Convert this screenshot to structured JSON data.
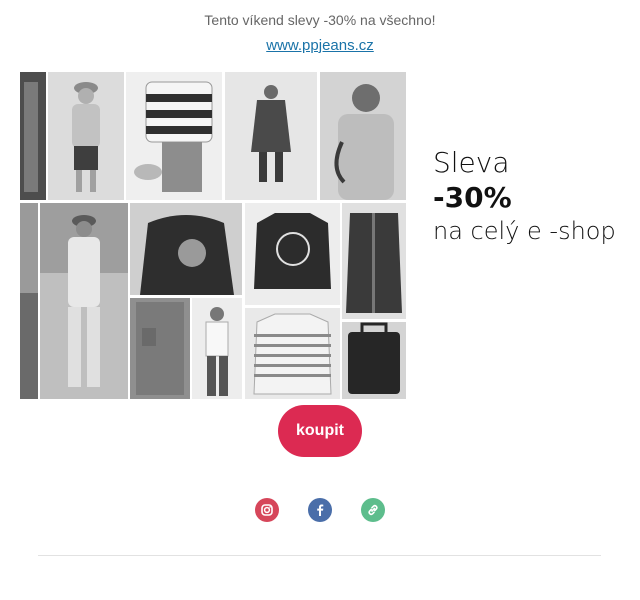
{
  "email": {
    "preheader": "Tento víkend slevy -30% na všechno!",
    "site_link": "www.ppjeans.cz"
  },
  "hero": {
    "line1": "Sleva",
    "line2": "-30%",
    "line3": "na celý e -shop"
  },
  "cta": {
    "label": "koupit"
  },
  "social": {
    "icons": [
      "instagram-icon",
      "facebook-icon",
      "link-icon"
    ],
    "colors": {
      "instagram": "#d6465a",
      "facebook": "#4a6ea9",
      "link": "#5dbd8c"
    }
  },
  "colors": {
    "accent": "#dc2a52",
    "link": "#1a73a8"
  }
}
